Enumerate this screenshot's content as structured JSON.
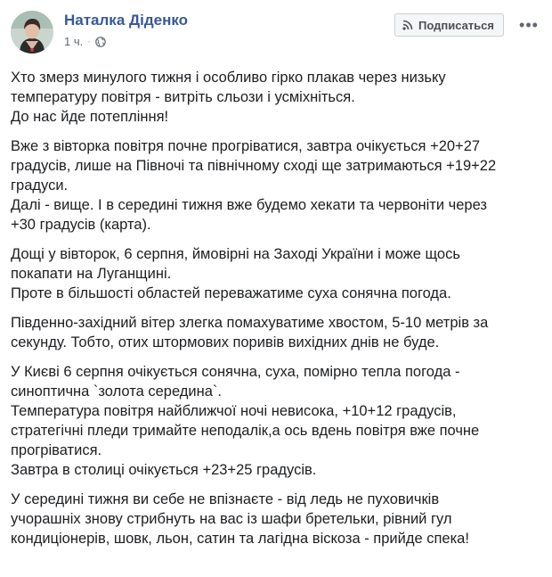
{
  "author": {
    "name": "Наталка Діденко",
    "time": "1 ч.",
    "separator": "·"
  },
  "header": {
    "subscribe_label": "Подписаться",
    "more_label": "•••"
  },
  "icons": {
    "avatar": "avatar-photo",
    "privacy": "globe-icon",
    "subscribe": "rss-icon",
    "more": "more-horizontal-icon"
  },
  "colors": {
    "author_link": "#385898",
    "text": "#1c1e21",
    "meta": "#616770",
    "button_bg": "#f5f6f7"
  },
  "post": {
    "paragraphs": [
      [
        "Хто змерз минулого тижня і особливо гірко плакав через низьку",
        "температуру повітря - витріть сльози і усміхніться.",
        "До нас йде потепління!"
      ],
      [
        "Вже з вівторка повітря почне прогріватися, завтра очікується +20+27",
        "градусів, лише на Півночі та північному сході ще затримаються +19+22",
        "градуси.",
        "Далі - вище. І в середині тижня вже будемо хекати та червоніти через",
        "+30 градусів (карта)."
      ],
      [
        "Дощі у вівторок, 6 серпня, ймовірні на Заході України і може щось",
        "покапати на Луганщині.",
        "Проте в більшості областей переважатиме суха сонячна погода."
      ],
      [
        "Південно-західний вітер злегка помахуватиме хвостом, 5-10 метрів за",
        "секунду. Тобто, отих штормових поривів вихідних днів не буде."
      ],
      [
        "У Києві 6 серпня очікується сонячна, суха, помірно тепла погода -",
        "синоптична `золота середина`.",
        "Температура повітря найближчої ночі невисока, +10+12 градусів,",
        "стратегічні пледи тримайте неподалік,а ось вдень повітря вже почне",
        "прогріватися.",
        "Завтра в столиці очікується +23+25 градусів."
      ],
      [
        "У середині тижня ви себе не впізнаєте - від ледь не пуховичків",
        "учорашніх знову стрибнуть на вас із шафи бретельки, рівний гул",
        "кондиціонерів, шовк, льон, сатин та лагідна віскоза - прийде спека!"
      ]
    ]
  }
}
